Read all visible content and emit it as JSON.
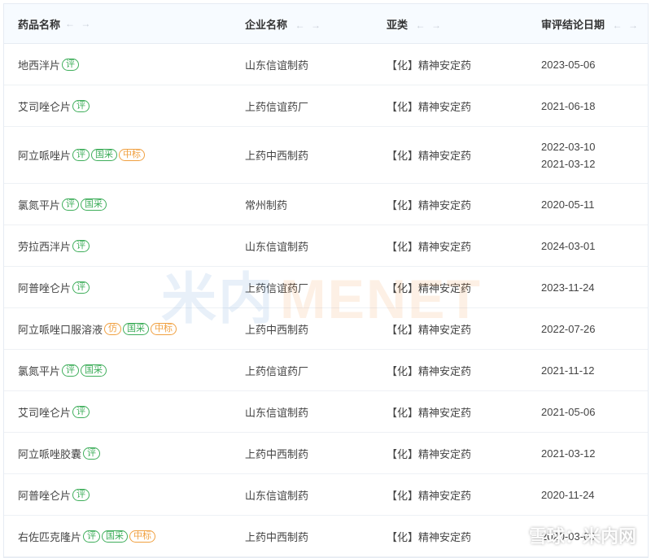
{
  "header": {
    "col1": "药品名称",
    "col2": "企业名称",
    "col3": "亚类",
    "col4": "审评结论日期",
    "sort_icon": "← →"
  },
  "rows": [
    {
      "name": "地西泮片",
      "badges": [
        {
          "t": "评",
          "c": "green"
        }
      ],
      "company": "山东信谊制药",
      "category": "【化】精神安定药",
      "dates": [
        "2023-05-06"
      ]
    },
    {
      "name": "艾司唑仑片",
      "badges": [
        {
          "t": "评",
          "c": "green"
        }
      ],
      "company": "上药信谊药厂",
      "category": "【化】精神安定药",
      "dates": [
        "2021-06-18"
      ]
    },
    {
      "name": "阿立哌唑片",
      "badges": [
        {
          "t": "评",
          "c": "green"
        },
        {
          "t": "国采",
          "c": "green"
        },
        {
          "t": "中标",
          "c": "orange"
        }
      ],
      "company": "上药中西制药",
      "category": "【化】精神安定药",
      "dates": [
        "2022-03-10",
        "2021-03-12"
      ]
    },
    {
      "name": "氯氮平片",
      "badges": [
        {
          "t": "评",
          "c": "green"
        },
        {
          "t": "国采",
          "c": "green"
        }
      ],
      "company": "常州制药",
      "category": "【化】精神安定药",
      "dates": [
        "2020-05-11"
      ]
    },
    {
      "name": "劳拉西泮片",
      "badges": [
        {
          "t": "评",
          "c": "green"
        }
      ],
      "company": "山东信谊制药",
      "category": "【化】精神安定药",
      "dates": [
        "2024-03-01"
      ]
    },
    {
      "name": "阿普唑仑片",
      "badges": [
        {
          "t": "评",
          "c": "green"
        }
      ],
      "company": "上药信谊药厂",
      "category": "【化】精神安定药",
      "dates": [
        "2023-11-24"
      ]
    },
    {
      "name": "阿立哌唑口服溶液",
      "badges": [
        {
          "t": "仿",
          "c": "orange"
        },
        {
          "t": "国采",
          "c": "green"
        },
        {
          "t": "中标",
          "c": "orange"
        }
      ],
      "company": "上药中西制药",
      "category": "【化】精神安定药",
      "dates": [
        "2022-07-26"
      ]
    },
    {
      "name": "氯氮平片",
      "badges": [
        {
          "t": "评",
          "c": "green"
        },
        {
          "t": "国采",
          "c": "green"
        }
      ],
      "company": "上药信谊药厂",
      "category": "【化】精神安定药",
      "dates": [
        "2021-11-12"
      ]
    },
    {
      "name": "艾司唑仑片",
      "badges": [
        {
          "t": "评",
          "c": "green"
        }
      ],
      "company": "山东信谊制药",
      "category": "【化】精神安定药",
      "dates": [
        "2021-05-06"
      ]
    },
    {
      "name": "阿立哌唑胶囊",
      "badges": [
        {
          "t": "评",
          "c": "green"
        }
      ],
      "company": "上药中西制药",
      "category": "【化】精神安定药",
      "dates": [
        "2021-03-12"
      ]
    },
    {
      "name": "阿普唑仑片",
      "badges": [
        {
          "t": "评",
          "c": "green"
        }
      ],
      "company": "山东信谊制药",
      "category": "【化】精神安定药",
      "dates": [
        "2020-11-24"
      ]
    },
    {
      "name": "右佐匹克隆片",
      "badges": [
        {
          "t": "评",
          "c": "green"
        },
        {
          "t": "国采",
          "c": "green"
        },
        {
          "t": "中标",
          "c": "orange"
        }
      ],
      "company": "上药中西制药",
      "category": "【化】精神安定药",
      "dates": [
        "2020-03-09"
      ]
    }
  ],
  "watermark": {
    "cn": "米内",
    "en": "MENET"
  },
  "corner_mark": "雪球：米内网",
  "colors": {
    "badge_green": "#3fae5b",
    "badge_orange": "#f0a040",
    "header_bg": "#f7fbff"
  }
}
